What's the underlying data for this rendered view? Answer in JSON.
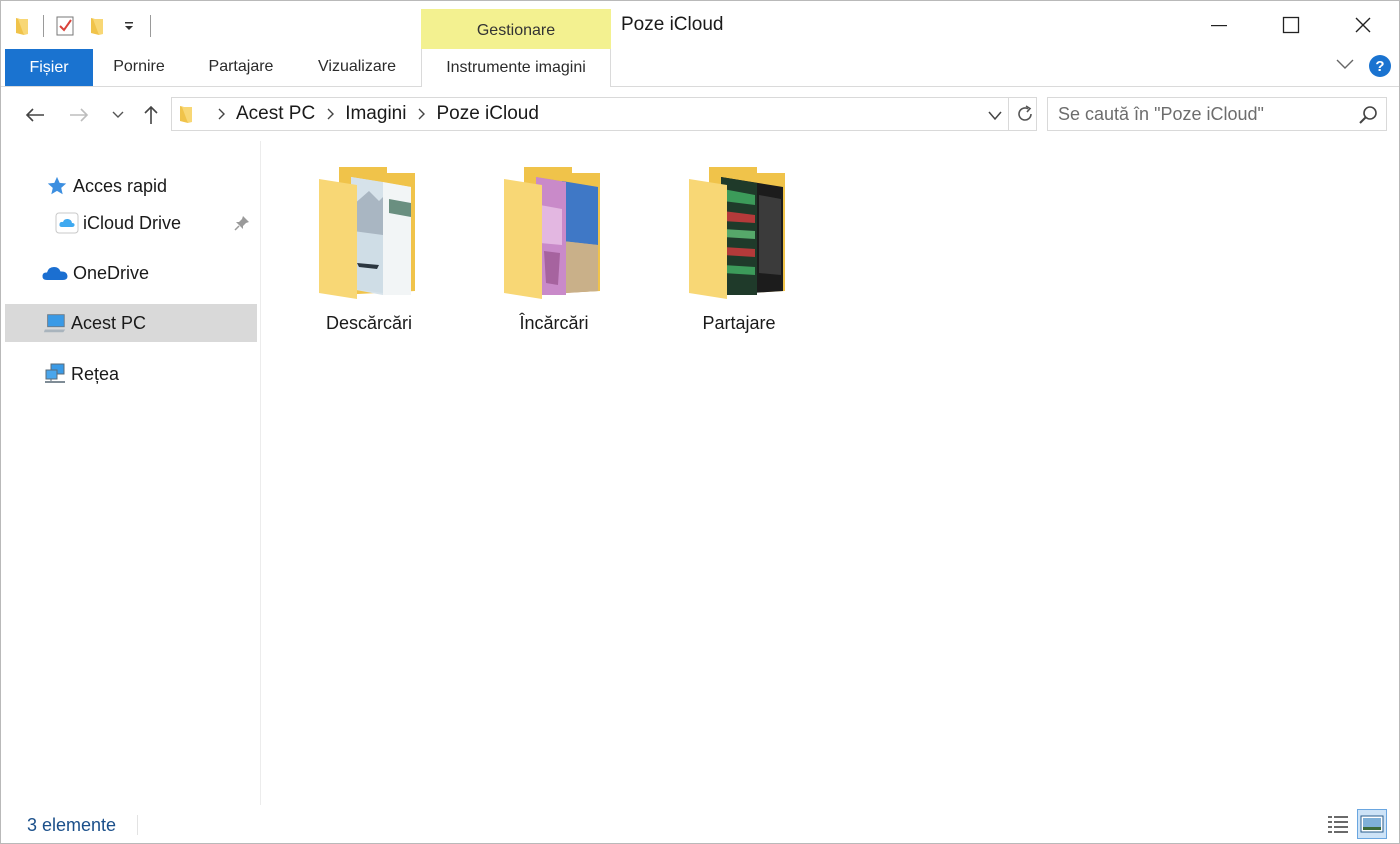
{
  "window": {
    "title": "Poze iCloud"
  },
  "ribbon": {
    "context_group": "Gestionare",
    "tabs": [
      "Fișier",
      "Pornire",
      "Partajare",
      "Vizualizare",
      "Instrumente imagini"
    ],
    "help": "?"
  },
  "address": {
    "crumbs": [
      "Acest PC",
      "Imagini",
      "Poze iCloud"
    ]
  },
  "search": {
    "placeholder": "Se caută în \"Poze iCloud\""
  },
  "nav": {
    "quick_access": "Acces rapid",
    "icloud_drive": "iCloud Drive",
    "onedrive": "OneDrive",
    "this_pc": "Acest PC",
    "network": "Rețea"
  },
  "folders": [
    "Descărcări",
    "Încărcări",
    "Partajare"
  ],
  "status": {
    "count": "3 elemente"
  },
  "colors": {
    "accent": "#1a73d0",
    "context_tab": "#f3f190",
    "folder": "#f8d775"
  }
}
